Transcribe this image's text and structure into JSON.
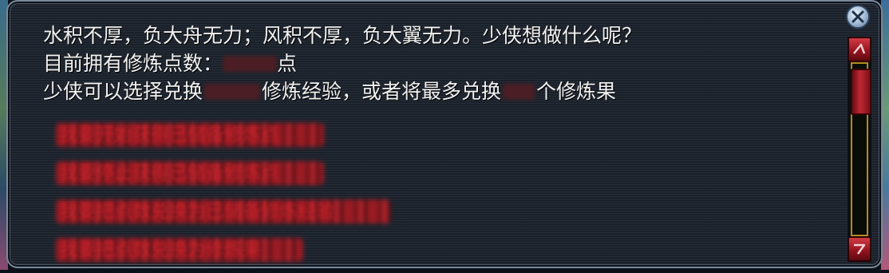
{
  "dialog": {
    "lines": [
      "水积不厚，负大舟无力；风积不厚，负大翼无力。少侠想做什么呢？",
      "目前拥有修炼点数：",
      "点",
      "少侠可以选择兑换",
      "修炼经验，或者将最多兑换",
      "个修炼果"
    ],
    "redacted_values": {
      "points": "",
      "exchangeable_exp": "",
      "max_fruits": ""
    },
    "options": [
      "我要开始获得已储备修炼点",
      "我要停止获得已储备修炼点",
      "我要把点数兑换为已储备修炼经验",
      "我要把点数兑换为修炼果"
    ]
  },
  "controls": {
    "close_icon": "close-x-icon",
    "scroll_up_icon": "triangle-up-icon",
    "scroll_down_icon": "triangle-down-icon"
  },
  "colors": {
    "dialog_bg": "#1e2530",
    "text": "#f2f2f2",
    "option_red": "#b01a22",
    "scroll_red": "#c02a34",
    "track_border": "#b48a1e"
  }
}
